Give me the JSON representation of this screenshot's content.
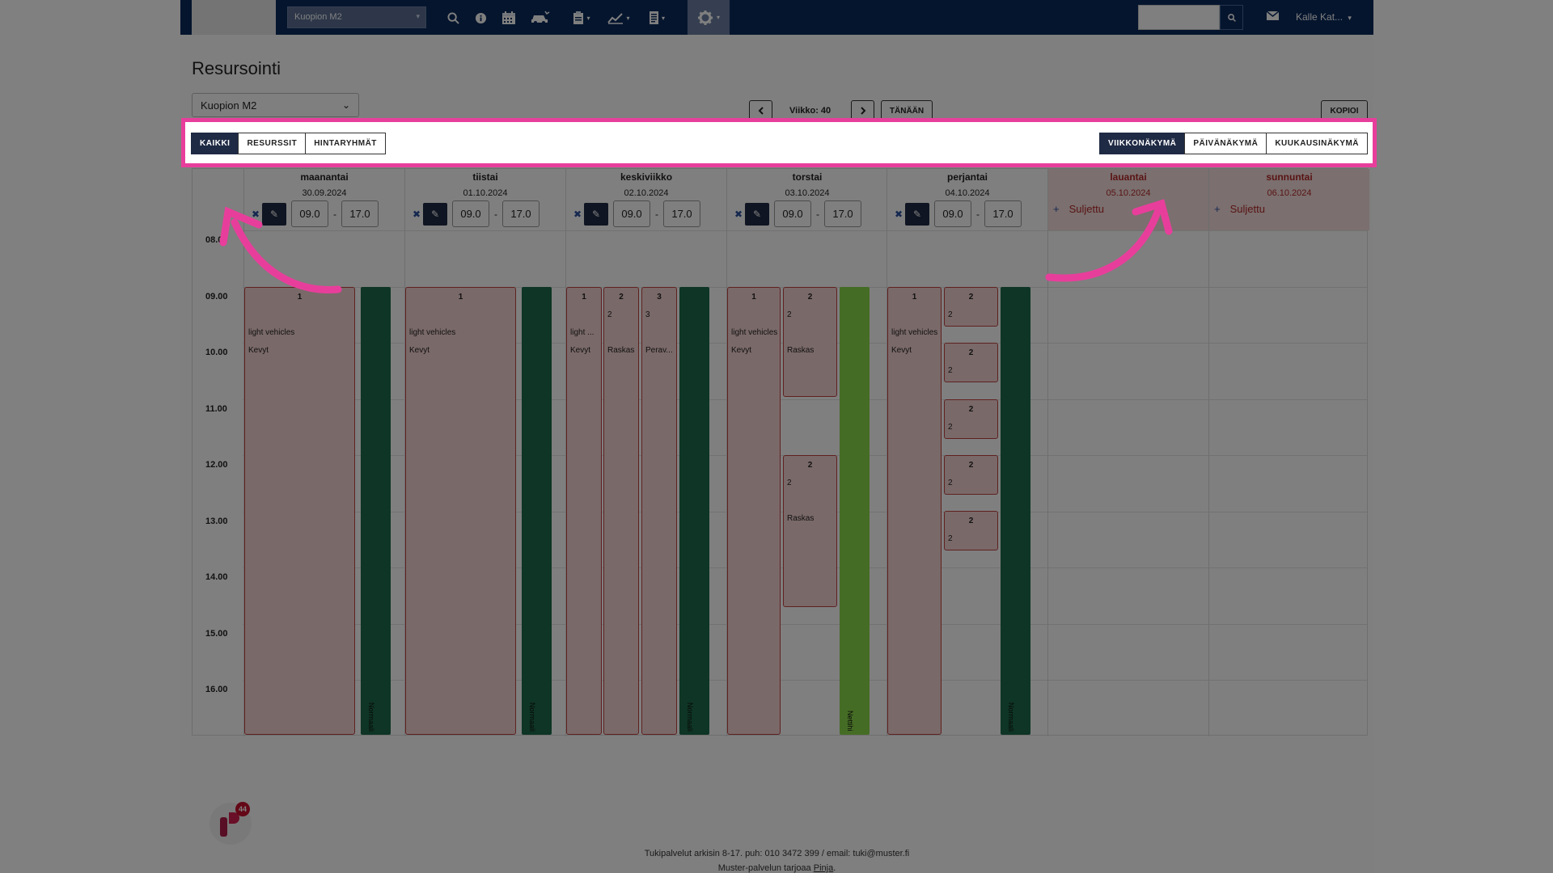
{
  "nav": {
    "location": "Kuopion M2",
    "user": "Kalle Kat...",
    "icons": [
      "search-icon",
      "info-icon",
      "calendar-icon",
      "car-icon",
      "clipboard-icon",
      "chart-icon",
      "document-icon",
      "gear-icon",
      "mail-icon"
    ]
  },
  "page": {
    "title": "Resursointi",
    "location": "Kuopion M2",
    "week_label": "Viikko: 40",
    "today_label": "TÄNÄÄN",
    "copy_label": "KOPIOI"
  },
  "filter_tabs": [
    {
      "label": "KAIKKI",
      "active": true
    },
    {
      "label": "RESURSSIT",
      "active": false
    },
    {
      "label": "HINTARYHMÄT",
      "active": false
    }
  ],
  "view_tabs": [
    {
      "label": "VIIKKONÄKYMÄ",
      "active": true
    },
    {
      "label": "PÄIVÄNÄKYMÄ",
      "active": false
    },
    {
      "label": "KUUKAUSINÄKYMÄ",
      "active": false
    }
  ],
  "days": [
    {
      "name": "maanantai",
      "date": "30.09.2024",
      "open": "09.0",
      "close": "17.0"
    },
    {
      "name": "tiistai",
      "date": "01.10.2024",
      "open": "09.0",
      "close": "17.0"
    },
    {
      "name": "keskiviikko",
      "date": "02.10.2024",
      "open": "09.0",
      "close": "17.0"
    },
    {
      "name": "torstai",
      "date": "03.10.2024",
      "open": "09.0",
      "close": "17.0"
    },
    {
      "name": "perjantai",
      "date": "04.10.2024",
      "open": "09.0",
      "close": "17.0"
    },
    {
      "name": "lauantai",
      "date": "05.10.2024",
      "closed_label": "Suljettu"
    },
    {
      "name": "sunnuntai",
      "date": "06.10.2024",
      "closed_label": "Suljettu"
    }
  ],
  "hours": [
    "08.00",
    "09.00",
    "10.00",
    "11.00",
    "12.00",
    "13.00",
    "14.00",
    "15.00",
    "16.00"
  ],
  "events": {
    "mon1": {
      "num": "1",
      "l1": "light vehicles",
      "l2": "Kevyt"
    },
    "mon_bar": "Normaali",
    "tue1": {
      "num": "1",
      "l1": "light vehicles",
      "l2": "Kevyt"
    },
    "tue_bar": "Normaali",
    "wed1": {
      "num": "1",
      "l1": "light ...",
      "l2": "Kevyt"
    },
    "wed2": {
      "num": "2",
      "l0": "2",
      "l2": "Raskas"
    },
    "wed3": {
      "num": "3",
      "l0": "3",
      "l2": "Perav..."
    },
    "wed_bar": "Normaali",
    "thu1": {
      "num": "1",
      "l1": "light vehicles",
      "l2": "Kevyt"
    },
    "thu2a": {
      "num": "2",
      "l0": "2",
      "l2": "Raskas"
    },
    "thu2b": {
      "num": "2",
      "l0": "2",
      "l2": "Raskas"
    },
    "thu_bar": "Nettihi",
    "fri1": {
      "num": "1",
      "l1": "light vehicles",
      "l2": "Kevyt"
    },
    "fri_small": {
      "num": "2",
      "l0": "2"
    },
    "fri_bar": "Normaali"
  },
  "footer": {
    "line1": "Tukipalvelut arkisin 8-17. puh: 010 3472 399 / email: tuki@muster.fi",
    "line2_pre": "Muster-palvelun tarjoaa ",
    "line2_link": "Pinja",
    "line2_post": "."
  },
  "badge_count": "44",
  "colors": {
    "nav": "#0b2a5c",
    "highlight": "#e83e9b",
    "event_fill": "#f4d2d2",
    "event_border": "#c04040",
    "bar_dark": "#1d6b4a",
    "bar_light": "#8bd94a"
  }
}
